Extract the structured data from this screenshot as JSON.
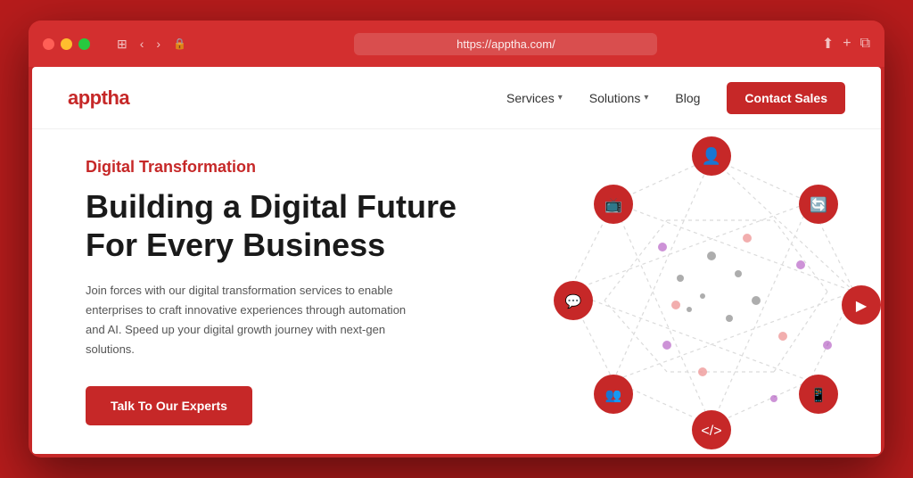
{
  "browser": {
    "url": "https://apptha.com/",
    "back_button": "‹",
    "forward_button": "›",
    "tab_icon": "⊞",
    "share_icon": "⬆",
    "add_tab_icon": "+",
    "windows_icon": "⧉"
  },
  "navbar": {
    "logo": "apptha",
    "links": [
      {
        "label": "Services",
        "has_dropdown": true
      },
      {
        "label": "Solutions",
        "has_dropdown": true
      },
      {
        "label": "Blog",
        "has_dropdown": false
      }
    ],
    "contact_button": "Contact Sales"
  },
  "hero": {
    "subtitle": "Digital Transformation",
    "title_line1": "Building a Digital Future",
    "title_line2": "For Every Business",
    "description": "Join forces with our digital transformation services to enable enterprises to craft innovative experiences through automation and AI. Speed up your digital growth journey with next-gen solutions.",
    "cta_button": "Talk To Our Experts"
  }
}
